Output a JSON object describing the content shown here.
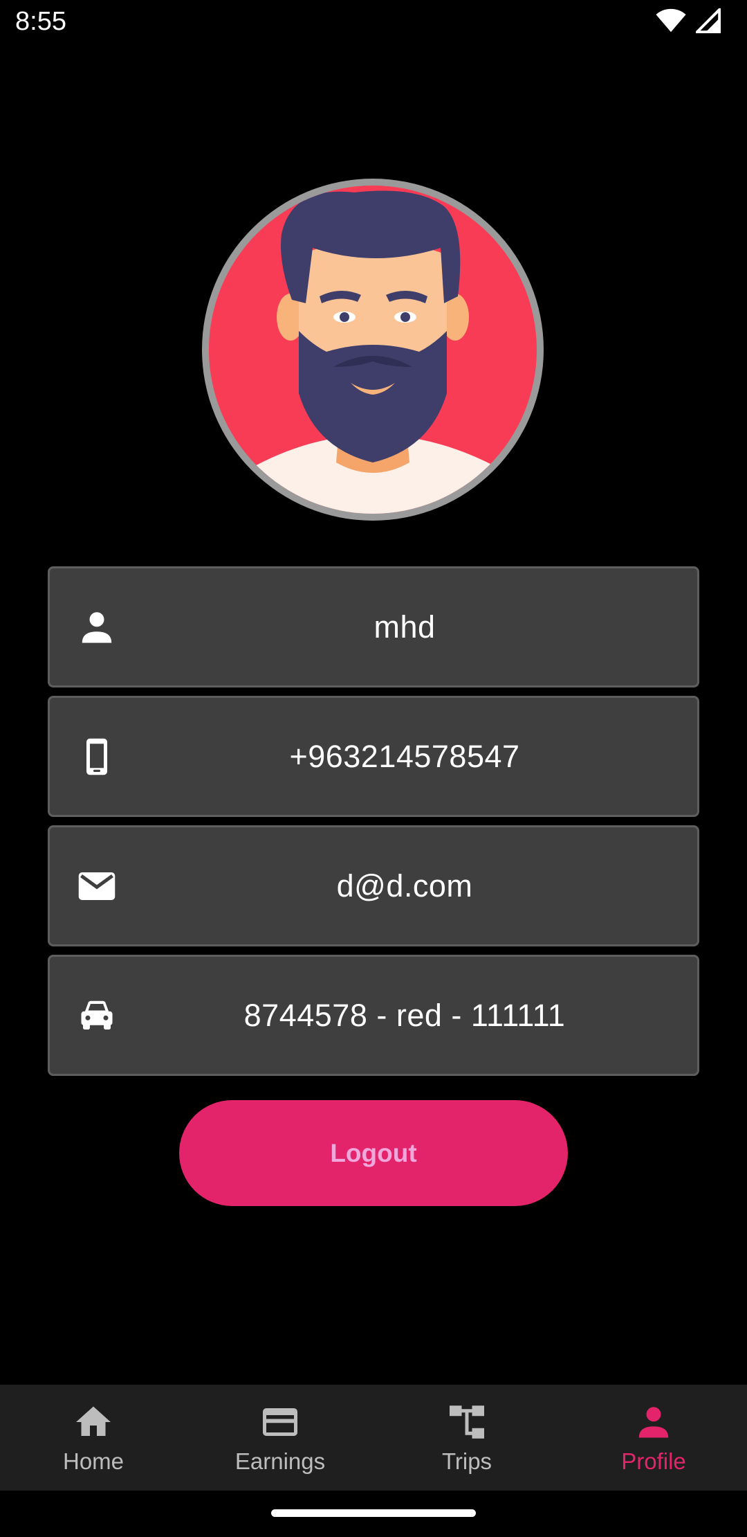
{
  "status_bar": {
    "time": "8:55",
    "icons": [
      "wifi-icon",
      "signal-icon"
    ]
  },
  "profile": {
    "avatar": "avatar-illustration",
    "fields": [
      {
        "icon": "person-icon",
        "value": "mhd"
      },
      {
        "icon": "smartphone-icon",
        "value": "+963214578547"
      },
      {
        "icon": "mail-icon",
        "value": "d@d.com"
      },
      {
        "icon": "car-icon",
        "value": "8744578 - red - 111111"
      }
    ]
  },
  "logout_label": "Logout",
  "bottom_nav": {
    "items": [
      {
        "label": "Home",
        "icon": "home-icon",
        "active": false
      },
      {
        "label": "Earnings",
        "icon": "credit-card-icon",
        "active": false
      },
      {
        "label": "Trips",
        "icon": "account-tree-icon",
        "active": false
      },
      {
        "label": "Profile",
        "icon": "person-icon",
        "active": true
      }
    ]
  },
  "colors": {
    "background": "#000000",
    "field_bg": "#3f3f3f",
    "accent": "#e3246a",
    "nav_bg": "#1f1f1f",
    "logout_text": "#f0a8dc"
  }
}
